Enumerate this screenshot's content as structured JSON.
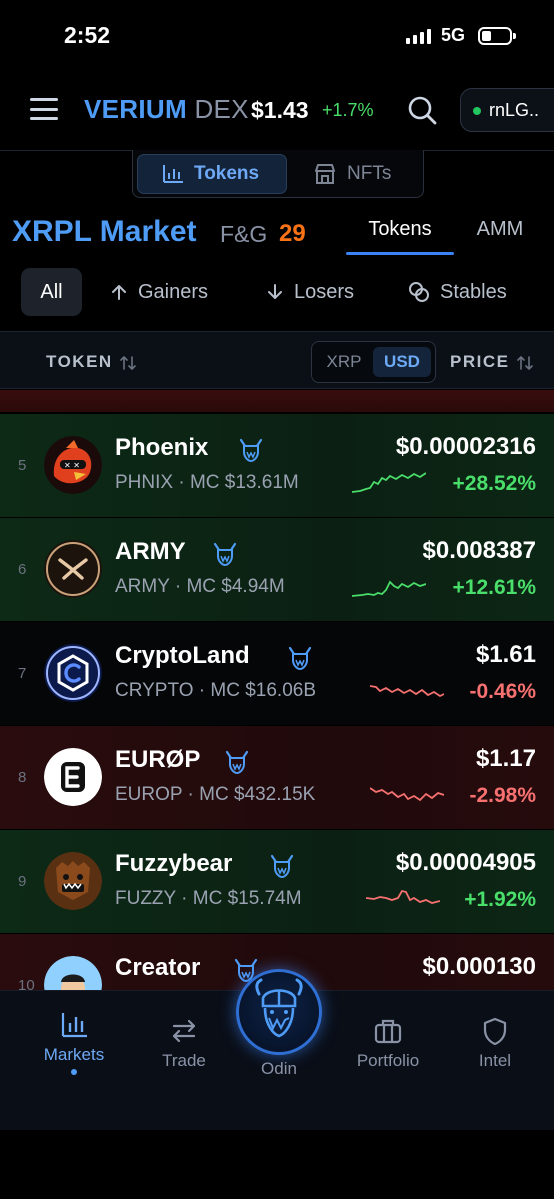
{
  "status_bar": {
    "time": "2:52",
    "network": "5G"
  },
  "header": {
    "brand_primary": "VERIUM",
    "brand_secondary": "DEX",
    "xrp_price": "$1.43",
    "xrp_change": "+1.7%",
    "wallet_label": "rnLG.."
  },
  "segment": {
    "tokens": "Tokens",
    "nfts": "NFTs"
  },
  "market": {
    "title": "XRPL Market",
    "fg_label": "F&G",
    "fg_value": "29",
    "tab_tokens": "Tokens",
    "tab_amm": "AMM"
  },
  "filters": {
    "all": "All",
    "gainers": "Gainers",
    "losers": "Losers",
    "stables": "Stables"
  },
  "table_header": {
    "token": "TOKEN",
    "xrp": "XRP",
    "usd": "USD",
    "price": "PRICE"
  },
  "rows": [
    {
      "rank": "5",
      "name": "Phoenix",
      "symbol": "PHNIX",
      "mc": "MC $13.61M",
      "price": "$0.00002316",
      "change": "+28.52%",
      "trend": "up"
    },
    {
      "rank": "6",
      "name": "ARMY",
      "symbol": "ARMY",
      "mc": "MC $4.94M",
      "price": "$0.008387",
      "change": "+12.61%",
      "trend": "up"
    },
    {
      "rank": "7",
      "name": "CryptoLand",
      "symbol": "CRYPTO",
      "mc": "MC $16.06B",
      "price": "$1.61",
      "change": "-0.46%",
      "trend": "down"
    },
    {
      "rank": "8",
      "name": "EURØP",
      "symbol": "EUROP",
      "mc": "MC $432.15K",
      "price": "$1.17",
      "change": "-2.98%",
      "trend": "down"
    },
    {
      "rank": "9",
      "name": "Fuzzybear",
      "symbol": "FUZZY",
      "mc": "MC $15.74M",
      "price": "$0.00004905",
      "change": "+1.92%",
      "trend": "up"
    },
    {
      "rank": "10",
      "name": "Creator",
      "symbol": "",
      "mc": "",
      "price": "$0.000130",
      "change": "",
      "trend": "down"
    }
  ],
  "nav": {
    "markets": "Markets",
    "trade": "Trade",
    "odin": "Odin",
    "portfolio": "Portfolio",
    "intel": "Intel"
  },
  "colors": {
    "accent": "#4f9cf7",
    "gain": "#4ade6a",
    "loss": "#f87171",
    "fg": "#f97316"
  },
  "icons": [
    "menu-icon",
    "search-icon",
    "chart-bars-icon",
    "store-icon",
    "arrow-up-icon",
    "arrow-down-icon",
    "coins-icon",
    "sort-icon",
    "viking-verified-icon",
    "swap-arrows-icon",
    "briefcase-icon",
    "shield-icon"
  ]
}
